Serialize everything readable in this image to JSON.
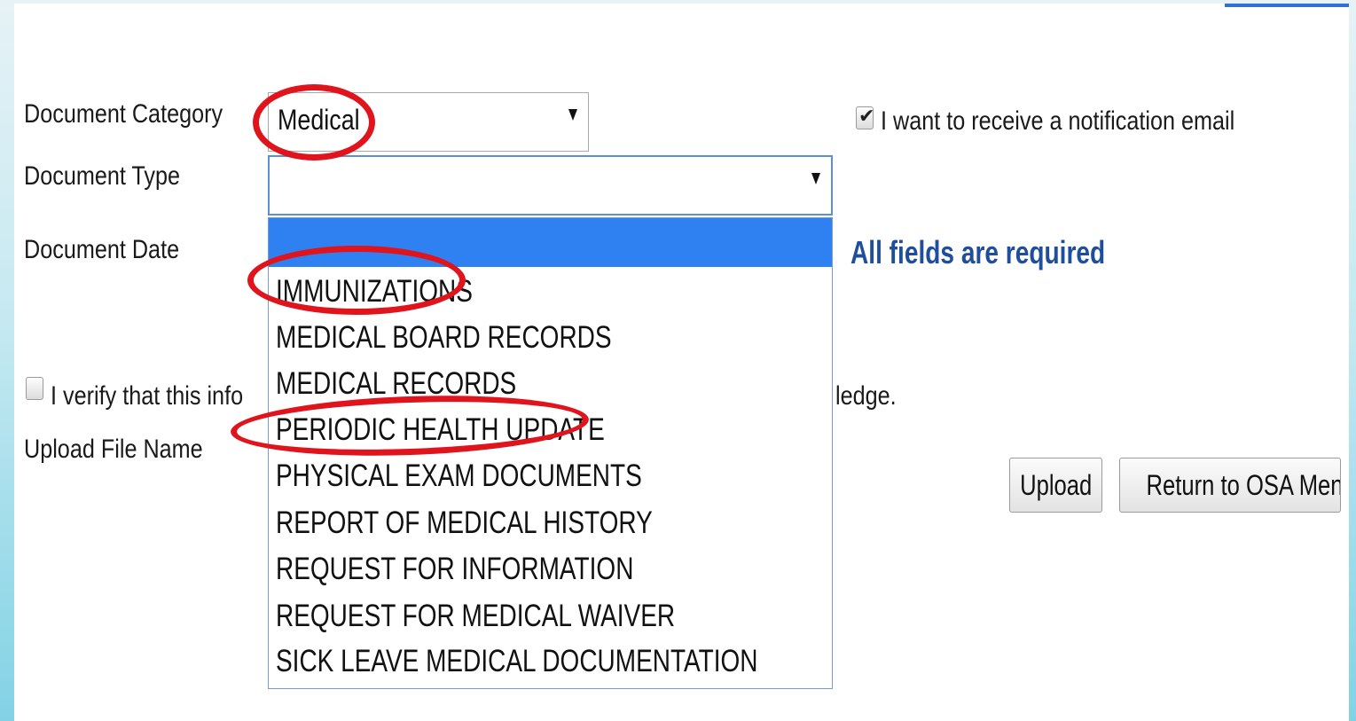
{
  "form": {
    "category_label": "Document Category",
    "category_value": "Medical",
    "type_label": "Document Type",
    "type_value": "",
    "date_label": "Document Date",
    "notify_label": "I want to receive a notification email",
    "notify_checked": true,
    "required_note": "All fields are required",
    "verify_label_start": "I verify that this info",
    "verify_label_end": "ledge.",
    "verify_checked": false,
    "upload_file_label": "Upload File Name",
    "upload_button": "Upload",
    "return_button": "Return to OSA Menu"
  },
  "dropdown": {
    "options": [
      "",
      "IMMUNIZATIONS",
      "MEDICAL BOARD RECORDS",
      "MEDICAL RECORDS",
      "PERIODIC HEALTH UPDATE",
      "PHYSICAL EXAM DOCUMENTS",
      "REPORT OF MEDICAL HISTORY",
      "REQUEST FOR INFORMATION",
      "REQUEST FOR MEDICAL WAIVER",
      "SICK LEAVE MEDICAL DOCUMENTATION"
    ],
    "selected_index": 0
  },
  "annotations": {
    "ring_color": "#e0141c",
    "circled": [
      "Medical",
      "IMMUNIZATIONS",
      "PERIODIC HEALTH UPDATE"
    ]
  },
  "colors": {
    "selection": "#2f80f0",
    "required_text": "#1f4e9c"
  }
}
